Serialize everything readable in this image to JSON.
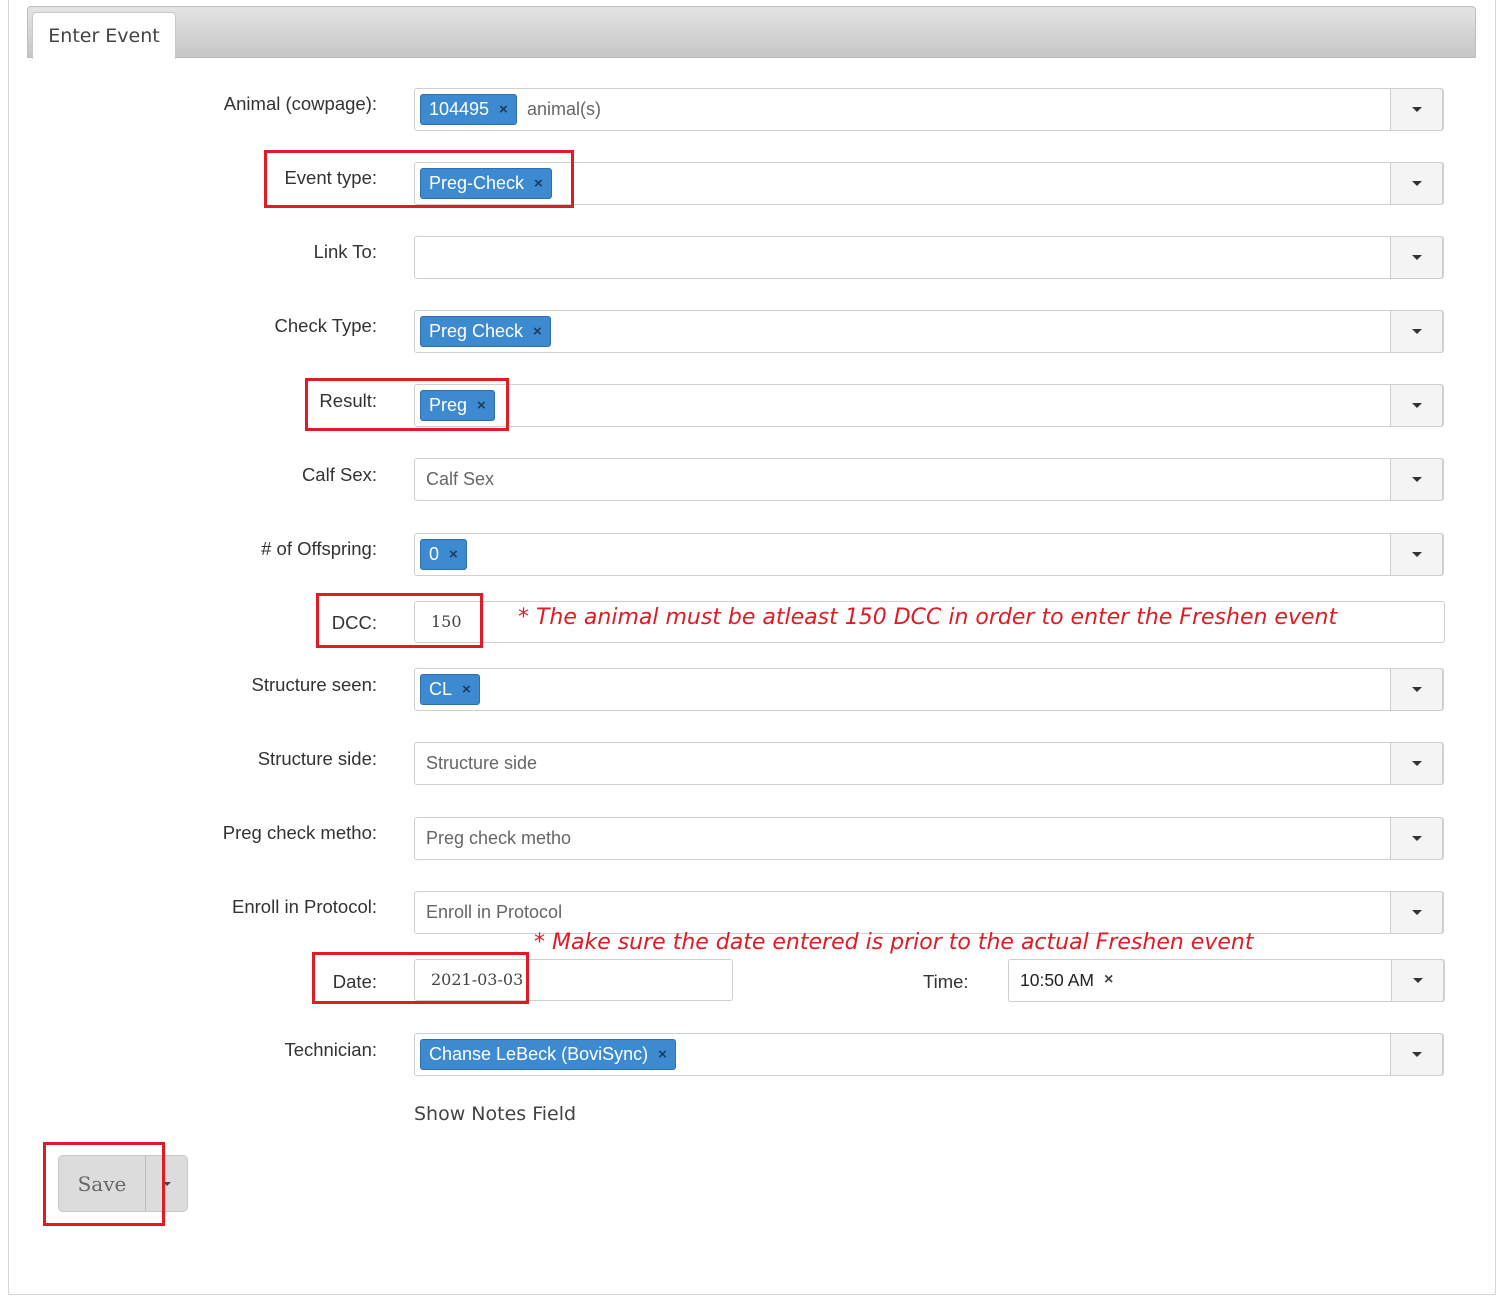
{
  "tab": {
    "label": "Enter Event"
  },
  "fields": {
    "animal": {
      "label": "Animal (cowpage):",
      "tag": "104495",
      "placeholder": "animal(s)"
    },
    "event_type": {
      "label": "Event type:",
      "tag": "Preg-Check"
    },
    "link_to": {
      "label": "Link To:"
    },
    "check_type": {
      "label": "Check Type:",
      "tag": "Preg Check"
    },
    "result": {
      "label": "Result:",
      "tag": "Preg"
    },
    "calf_sex": {
      "label": "Calf Sex:",
      "placeholder": "Calf Sex"
    },
    "offspring": {
      "label": "# of Offspring:",
      "tag": "0"
    },
    "dcc": {
      "label": "DCC:",
      "value": "150"
    },
    "structure_seen": {
      "label": "Structure seen:",
      "tag": "CL"
    },
    "structure_side": {
      "label": "Structure side:",
      "placeholder": "Structure side"
    },
    "preg_check_method": {
      "label": "Preg check metho:",
      "placeholder": "Preg check metho"
    },
    "enroll_protocol": {
      "label": "Enroll in Protocol:",
      "placeholder": "Enroll in Protocol"
    },
    "date": {
      "label": "Date:",
      "value": "2021-03-03"
    },
    "time": {
      "label": "Time:",
      "value": "10:50 AM"
    },
    "technician": {
      "label": "Technician:",
      "tag": "Chanse LeBeck (BoviSync)"
    }
  },
  "notes": {
    "dcc_note": "* The animal must be atleast 150 DCC in order to enter the Freshen event",
    "date_note": "* Make sure the date entered is prior to the actual Freshen event"
  },
  "links": {
    "show_notes": "Show Notes Field"
  },
  "buttons": {
    "save": "Save"
  },
  "icons": {
    "remove": "×",
    "dropdown": "caret-down-icon"
  },
  "colors": {
    "tag_bg": "#3d8ad1",
    "annotation_red": "#e01b24"
  }
}
